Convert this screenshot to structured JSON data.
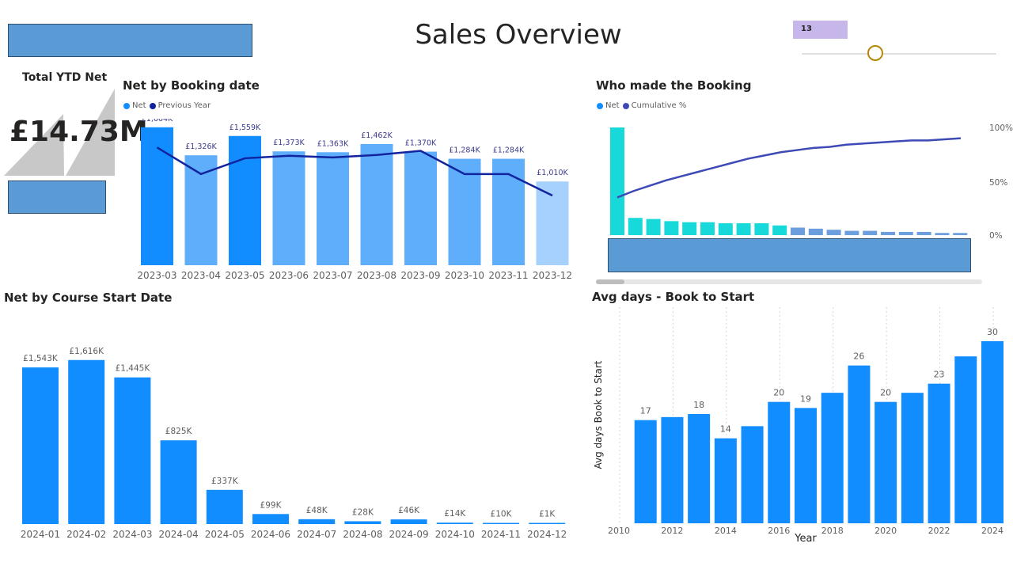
{
  "page": {
    "title": "Sales Overview"
  },
  "slider": {
    "value": "13",
    "position": 0.38
  },
  "kpi": {
    "label": "Total YTD Net",
    "value": "£14.73M"
  },
  "colors": {
    "bar_dark": "#118dff",
    "bar_mid": "#5eaefc",
    "bar_light": "#a6d0fd",
    "line_prev": "#12239e",
    "teal": "#18d9d9",
    "cumulative": "#3d4ab5",
    "pareto_faded": "#6b9ede",
    "kpi_area": "#c8c8c8",
    "placeholder": "#5b9bd5"
  },
  "chart_data": [
    {
      "type": "bar",
      "title": "Net by Booking date",
      "legend": [
        "Net",
        "Previous Year"
      ],
      "categories": [
        "2023-03",
        "2023-04",
        "2023-05",
        "2023-06",
        "2023-07",
        "2023-08",
        "2023-09",
        "2023-10",
        "2023-11",
        "2023-12"
      ],
      "series": [
        {
          "name": "Net",
          "values": [
            1664,
            1326,
            1559,
            1373,
            1363,
            1462,
            1370,
            1284,
            1284,
            1010
          ],
          "labels": [
            "£1,664K",
            "£1,326K",
            "£1,559K",
            "£1,373K",
            "£1,363K",
            "£1,462K",
            "£1,370K",
            "£1,284K",
            "£1,284K",
            "£1,010K"
          ]
        },
        {
          "name": "Previous Year",
          "values": [
            1420,
            1100,
            1290,
            1320,
            1300,
            1330,
            1380,
            1100,
            1100,
            840
          ]
        }
      ],
      "ylim": [
        0,
        1700
      ]
    },
    {
      "type": "bar",
      "title": "Who made the Booking",
      "legend": [
        "Net",
        "Cumulative %"
      ],
      "series": [
        {
          "name": "Net",
          "values": [
            100,
            16,
            15,
            13,
            12,
            12,
            11,
            11,
            11,
            9,
            7,
            6,
            5,
            4,
            4,
            3,
            3,
            3,
            2,
            2
          ]
        },
        {
          "name": "Cumulative %",
          "values": [
            35,
            41,
            46,
            51,
            55,
            59,
            63,
            67,
            71,
            74,
            77,
            79,
            81,
            82,
            84,
            85,
            86,
            87,
            88,
            88,
            89,
            90
          ]
        }
      ],
      "y2_ticks": [
        "100%",
        "50%",
        "0%"
      ]
    },
    {
      "type": "bar",
      "title": "Net by Course Start Date",
      "categories": [
        "2024-01",
        "2024-02",
        "2024-03",
        "2024-04",
        "2024-05",
        "2024-06",
        "2024-07",
        "2024-08",
        "2024-09",
        "2024-10",
        "2024-11",
        "2024-12"
      ],
      "values": [
        1543,
        1616,
        1445,
        825,
        337,
        99,
        48,
        28,
        46,
        14,
        10,
        1
      ],
      "labels": [
        "£1,543K",
        "£1,616K",
        "£1,445K",
        "£825K",
        "£337K",
        "£99K",
        "£48K",
        "£28K",
        "£46K",
        "£14K",
        "£10K",
        "£1K"
      ],
      "ylim": [
        0,
        1700
      ]
    },
    {
      "type": "bar",
      "title": "Avg days - Book to Start",
      "xlabel": "Year",
      "ylabel": "Avg days Book to Start",
      "x": [
        2011,
        2012,
        2013,
        2014,
        2015,
        2016,
        2017,
        2018,
        2019,
        2020,
        2021,
        2022,
        2023,
        2024
      ],
      "values": [
        17,
        17.5,
        18,
        14,
        16,
        20,
        19,
        21.5,
        26,
        20,
        21.5,
        23,
        27.5,
        30
      ],
      "data_labels": {
        "2011": "17",
        "2013": "18",
        "2014": "14",
        "2016": "20",
        "2017": "19",
        "2019": "26",
        "2020": "20",
        "2022": "23",
        "2024": "30"
      },
      "x_ticks": [
        2010,
        2012,
        2014,
        2016,
        2018,
        2020,
        2022,
        2024
      ],
      "xlim": [
        2010,
        2024
      ],
      "ylim": [
        0,
        30
      ]
    }
  ]
}
